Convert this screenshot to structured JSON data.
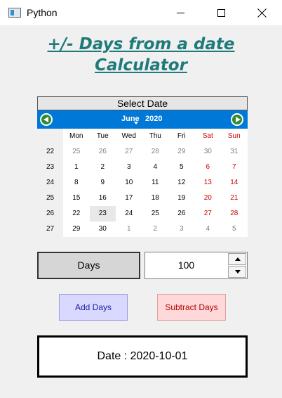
{
  "window": {
    "title": "Python"
  },
  "heading": {
    "line1": "+/- Days from a date",
    "line2": "Calculator"
  },
  "calendar": {
    "header": "Select Date",
    "month": "June",
    "year": "2020",
    "weekdays": [
      "Mon",
      "Tue",
      "Wed",
      "Thu",
      "Fri",
      "Sat",
      "Sun"
    ],
    "weeks": [
      {
        "num": "22",
        "days": [
          "25",
          "26",
          "27",
          "28",
          "29",
          "30",
          "31"
        ]
      },
      {
        "num": "23",
        "days": [
          "1",
          "2",
          "3",
          "4",
          "5",
          "6",
          "7"
        ]
      },
      {
        "num": "24",
        "days": [
          "8",
          "9",
          "10",
          "11",
          "12",
          "13",
          "14"
        ]
      },
      {
        "num": "25",
        "days": [
          "15",
          "16",
          "17",
          "18",
          "19",
          "20",
          "21"
        ]
      },
      {
        "num": "26",
        "days": [
          "22",
          "23",
          "24",
          "25",
          "26",
          "27",
          "28"
        ]
      },
      {
        "num": "27",
        "days": [
          "29",
          "30",
          "1",
          "2",
          "3",
          "4",
          "5"
        ]
      }
    ],
    "selected_day": "23"
  },
  "days_label": "Days",
  "days_value": "100",
  "buttons": {
    "add": "Add Days",
    "subtract": "Subtract Days"
  },
  "result": "Date : 2020-10-01",
  "colors": {
    "heading": "#1f7a7a",
    "calendar_nav": "#0078d7",
    "weekend": "#cc0000",
    "add_bg": "#d9d9ff",
    "subtract_bg": "#ffd9d9"
  }
}
